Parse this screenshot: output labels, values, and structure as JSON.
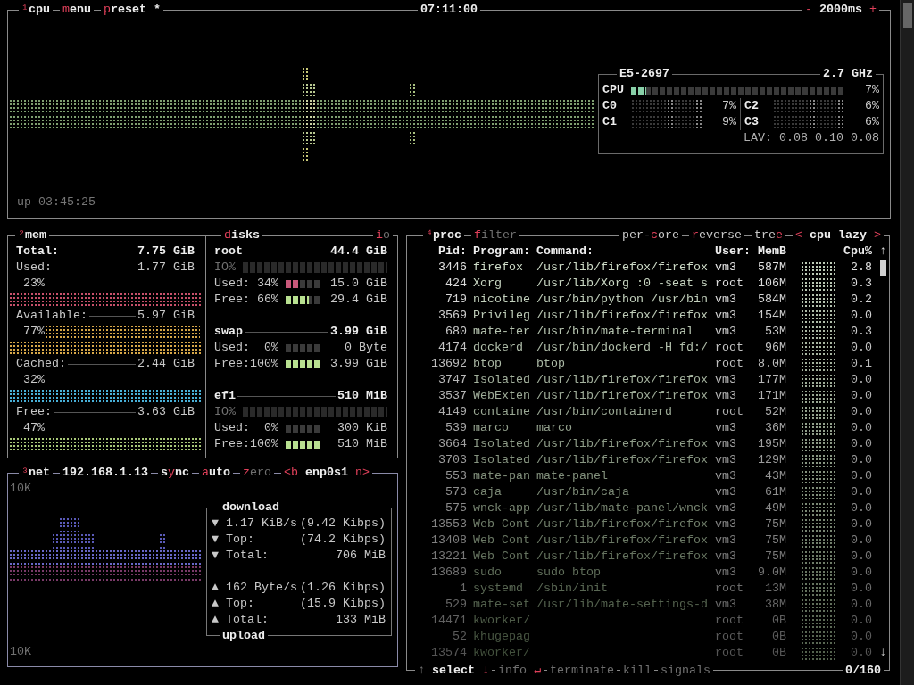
{
  "cpu": {
    "header": {
      "left": [
        {
          "parts": [
            {
              "text": "¹",
              "kind": "hot"
            },
            {
              "text": "cpu",
              "kind": "bold"
            }
          ]
        },
        {
          "parts": [
            {
              "text": "m",
              "kind": "hot"
            },
            {
              "text": "enu",
              "kind": "bold"
            }
          ]
        },
        {
          "parts": [
            {
              "text": "p",
              "kind": "hot"
            },
            {
              "text": "reset *",
              "kind": "bold"
            }
          ]
        }
      ],
      "clock": "07:11:00",
      "right": [
        {
          "parts": [
            {
              "text": "-",
              "kind": "hot"
            },
            {
              "text": " 2000ms ",
              "kind": "bold"
            },
            {
              "text": "+",
              "kind": "hot"
            }
          ]
        }
      ]
    },
    "info": {
      "model": "E5-2697",
      "frequency": "2.7 GHz",
      "total": {
        "label": "CPU",
        "level": 0.07,
        "reading": "7%"
      },
      "cores": [
        {
          "label": "C0",
          "reading": "7%"
        },
        {
          "label": "C2",
          "reading": "6%"
        },
        {
          "label": "C1",
          "reading": "9%"
        },
        {
          "label": "C3",
          "reading": "6%"
        }
      ],
      "load": "LAV: 0.08 0.10 0.08"
    },
    "uptime": "up 03:45:25"
  },
  "mem": {
    "header": [
      {
        "parts": [
          {
            "text": "²",
            "kind": "hot"
          },
          {
            "text": "mem",
            "kind": "bold"
          }
        ]
      }
    ],
    "total": {
      "label": "Total:",
      "value": "7.75 GiB"
    },
    "stats": [
      {
        "label": "Used:",
        "value": "1.77 GiB",
        "percent": "23%",
        "color": "#c8506a",
        "kind": "short"
      },
      {
        "label": "Available:",
        "value": "5.97 GiB",
        "percent": "77%",
        "color": "#d8a848",
        "kind": "tall"
      },
      {
        "label": "Cached:",
        "value": "2.44 GiB",
        "percent": "32%",
        "color": "#48b0d8",
        "kind": "short"
      },
      {
        "label": "Free:",
        "value": "3.63 GiB",
        "percent": "47%",
        "color": "#a8c878",
        "kind": "short"
      }
    ]
  },
  "disks": {
    "header": {
      "left": [
        {
          "parts": [
            {
              "text": "d",
              "kind": "hot"
            },
            {
              "text": "isks",
              "kind": "bold"
            }
          ]
        }
      ],
      "right": [
        {
          "parts": [
            {
              "text": "i",
              "kind": "hot"
            },
            {
              "text": "o",
              "kind": "dim"
            }
          ]
        }
      ]
    },
    "items": [
      {
        "name": "root",
        "size": "44.4 GiB",
        "rows": [
          {
            "kind": "io",
            "label": "IO%"
          },
          {
            "kind": "used",
            "label": "Used:",
            "percent": "34%",
            "level": 0.34,
            "value": "15.0 GiB"
          },
          {
            "kind": "free",
            "label": "Free:",
            "percent": "66%",
            "level": 0.66,
            "value": "29.4 GiB"
          }
        ]
      },
      {
        "name": "swap",
        "size": "3.99 GiB",
        "rows": [
          {
            "kind": "used",
            "label": "Used:",
            "percent": "0%",
            "level": 0,
            "value": "0 Byte"
          },
          {
            "kind": "free",
            "label": "Free:",
            "percent": "100%",
            "level": 1,
            "value": "3.99 GiB"
          }
        ]
      },
      {
        "name": "efi",
        "size": "510 MiB",
        "rows": [
          {
            "kind": "io",
            "label": "IO%"
          },
          {
            "kind": "used",
            "label": "Used:",
            "percent": "0%",
            "level": 0,
            "value": "300 KiB"
          },
          {
            "kind": "free",
            "label": "Free:",
            "percent": "100%",
            "level": 1,
            "value": "510 MiB"
          }
        ]
      }
    ]
  },
  "net": {
    "header": [
      {
        "parts": [
          {
            "text": "³",
            "kind": "hot"
          },
          {
            "text": "net",
            "kind": "bold"
          }
        ]
      },
      {
        "parts": [
          {
            "text": "192.168.1.13",
            "kind": "bold"
          }
        ]
      },
      {
        "parts": [
          {
            "text": "s",
            "kind": "bold"
          },
          {
            "text": "y",
            "kind": "hot"
          },
          {
            "text": "nc",
            "kind": "bold"
          }
        ]
      },
      {
        "parts": [
          {
            "text": "a",
            "kind": "hot"
          },
          {
            "text": "uto",
            "kind": "bold"
          }
        ]
      },
      {
        "parts": [
          {
            "text": "z",
            "kind": "hot"
          },
          {
            "text": "ero",
            "kind": "dim"
          }
        ]
      },
      {
        "parts": [
          {
            "text": "<b",
            "kind": "hot"
          },
          {
            "text": " enp0s1 ",
            "kind": "bold"
          },
          {
            "text": "n>",
            "kind": "hot"
          }
        ]
      }
    ],
    "scale_top": "10K",
    "scale_bottom": "10K",
    "download": {
      "title": "download",
      "rows": [
        {
          "arrow": "▼",
          "label": "1.17 KiB/s",
          "value": "(9.42 Kibps)"
        },
        {
          "arrow": "▼",
          "label": "Top:",
          "value": "(74.2 Kibps)"
        },
        {
          "arrow": "▼",
          "label": "Total:",
          "value": "706 MiB"
        }
      ]
    },
    "upload": {
      "title": "upload",
      "rows": [
        {
          "arrow": "▲",
          "label": "162 Byte/s",
          "value": "(1.26 Kibps)"
        },
        {
          "arrow": "▲",
          "label": "Top:",
          "value": "(15.9 Kibps)"
        },
        {
          "arrow": "▲",
          "label": "Total:",
          "value": "133 MiB"
        }
      ]
    }
  },
  "proc": {
    "header": {
      "left": [
        {
          "parts": [
            {
              "text": "⁴",
              "kind": "hot"
            },
            {
              "text": "proc",
              "kind": "bold"
            }
          ]
        },
        {
          "parts": [
            {
              "text": "f",
              "kind": "hot"
            },
            {
              "text": "ilter",
              "kind": "dim"
            }
          ]
        }
      ],
      "right": [
        {
          "parts": [
            {
              "text": "per-",
              "kind": "plain"
            },
            {
              "text": "c",
              "kind": "hot"
            },
            {
              "text": "ore",
              "kind": "plain"
            }
          ]
        },
        {
          "parts": [
            {
              "text": "r",
              "kind": "hot"
            },
            {
              "text": "everse",
              "kind": "plain"
            }
          ]
        },
        {
          "parts": [
            {
              "text": "tre",
              "kind": "plain"
            },
            {
              "text": "e",
              "kind": "hot"
            }
          ]
        },
        {
          "parts": [
            {
              "text": "<",
              "kind": "hot"
            },
            {
              "text": " cpu lazy ",
              "kind": "bold"
            },
            {
              "text": ">",
              "kind": "hot"
            }
          ]
        }
      ]
    },
    "columns": [
      "Pid:",
      "Program:",
      "Command:",
      "User:",
      "MemB",
      "Cpu%"
    ],
    "scroll_up": "↑",
    "scroll_down": "↓",
    "rows": [
      {
        "pid": "3446",
        "program": "firefox",
        "command": "/usr/lib/firefox/firefox",
        "user": "vm3",
        "memory": "587M",
        "cpu": "2.8"
      },
      {
        "pid": "424",
        "program": "Xorg",
        "command": "/usr/lib/Xorg :0 -seat s",
        "user": "root",
        "memory": "106M",
        "cpu": "0.3"
      },
      {
        "pid": "719",
        "program": "nicotine",
        "command": "/usr/bin/python /usr/bin",
        "user": "vm3",
        "memory": "584M",
        "cpu": "0.2"
      },
      {
        "pid": "3569",
        "program": "Privileg",
        "command": "/usr/lib/firefox/firefox",
        "user": "vm3",
        "memory": "154M",
        "cpu": "0.0"
      },
      {
        "pid": "680",
        "program": "mate-ter",
        "command": "/usr/bin/mate-terminal",
        "user": "vm3",
        "memory": "53M",
        "cpu": "0.3"
      },
      {
        "pid": "4174",
        "program": "dockerd",
        "command": "/usr/bin/dockerd -H fd:/",
        "user": "root",
        "memory": "96M",
        "cpu": "0.0"
      },
      {
        "pid": "13692",
        "program": "btop",
        "command": "btop",
        "user": "root",
        "memory": "8.0M",
        "cpu": "0.1"
      },
      {
        "pid": "3747",
        "program": "Isolated",
        "command": "/usr/lib/firefox/firefox",
        "user": "vm3",
        "memory": "177M",
        "cpu": "0.0"
      },
      {
        "pid": "3537",
        "program": "WebExten",
        "command": "/usr/lib/firefox/firefox",
        "user": "vm3",
        "memory": "171M",
        "cpu": "0.0"
      },
      {
        "pid": "4149",
        "program": "containe",
        "command": "/usr/bin/containerd",
        "user": "root",
        "memory": "52M",
        "cpu": "0.0"
      },
      {
        "pid": "539",
        "program": "marco",
        "command": "marco",
        "user": "vm3",
        "memory": "36M",
        "cpu": "0.0"
      },
      {
        "pid": "3664",
        "program": "Isolated",
        "command": "/usr/lib/firefox/firefox",
        "user": "vm3",
        "memory": "195M",
        "cpu": "0.0"
      },
      {
        "pid": "3703",
        "program": "Isolated",
        "command": "/usr/lib/firefox/firefox",
        "user": "vm3",
        "memory": "129M",
        "cpu": "0.0"
      },
      {
        "pid": "553",
        "program": "mate-pan",
        "command": "mate-panel",
        "user": "vm3",
        "memory": "43M",
        "cpu": "0.0"
      },
      {
        "pid": "573",
        "program": "caja",
        "command": "/usr/bin/caja",
        "user": "vm3",
        "memory": "61M",
        "cpu": "0.0"
      },
      {
        "pid": "575",
        "program": "wnck-app",
        "command": "/usr/lib/mate-panel/wnck",
        "user": "vm3",
        "memory": "49M",
        "cpu": "0.0"
      },
      {
        "pid": "13553",
        "program": "Web Cont",
        "command": "/usr/lib/firefox/firefox",
        "user": "vm3",
        "memory": "75M",
        "cpu": "0.0"
      },
      {
        "pid": "13408",
        "program": "Web Cont",
        "command": "/usr/lib/firefox/firefox",
        "user": "vm3",
        "memory": "75M",
        "cpu": "0.0"
      },
      {
        "pid": "13221",
        "program": "Web Cont",
        "command": "/usr/lib/firefox/firefox",
        "user": "vm3",
        "memory": "75M",
        "cpu": "0.0"
      },
      {
        "pid": "13689",
        "program": "sudo",
        "command": "sudo btop",
        "user": "vm3",
        "memory": "9.0M",
        "cpu": "0.0"
      },
      {
        "pid": "1",
        "program": "systemd",
        "command": "/sbin/init",
        "user": "root",
        "memory": "13M",
        "cpu": "0.0"
      },
      {
        "pid": "529",
        "program": "mate-set",
        "command": "/usr/lib/mate-settings-d",
        "user": "vm3",
        "memory": "38M",
        "cpu": "0.0"
      },
      {
        "pid": "14471",
        "program": "kworker/",
        "user": "root",
        "memory": "0B",
        "cpu": "0.0"
      },
      {
        "pid": "52",
        "program": "khugepag",
        "user": "root",
        "memory": "0B",
        "cpu": "0.0"
      },
      {
        "pid": "13574",
        "program": "kworker/",
        "user": "root",
        "memory": "0B",
        "cpu": "0.0"
      }
    ],
    "footer": {
      "left": [
        {
          "parts": [
            {
              "text": "↑",
              "kind": "dim"
            },
            {
              "text": " select ",
              "kind": "bold"
            },
            {
              "text": "↓",
              "kind": "hot"
            }
          ]
        },
        {
          "parts": [
            {
              "text": "info ",
              "kind": "dim"
            },
            {
              "text": "↵",
              "kind": "hot"
            }
          ]
        },
        {
          "parts": [
            {
              "text": "terminate",
              "kind": "dim"
            }
          ]
        },
        {
          "parts": [
            {
              "text": "kill",
              "kind": "dim"
            }
          ]
        },
        {
          "parts": [
            {
              "text": "signals",
              "kind": "dim"
            }
          ]
        }
      ],
      "right": [
        {
          "parts": [
            {
              "text": "0/160",
              "kind": "bold"
            }
          ]
        }
      ]
    }
  }
}
